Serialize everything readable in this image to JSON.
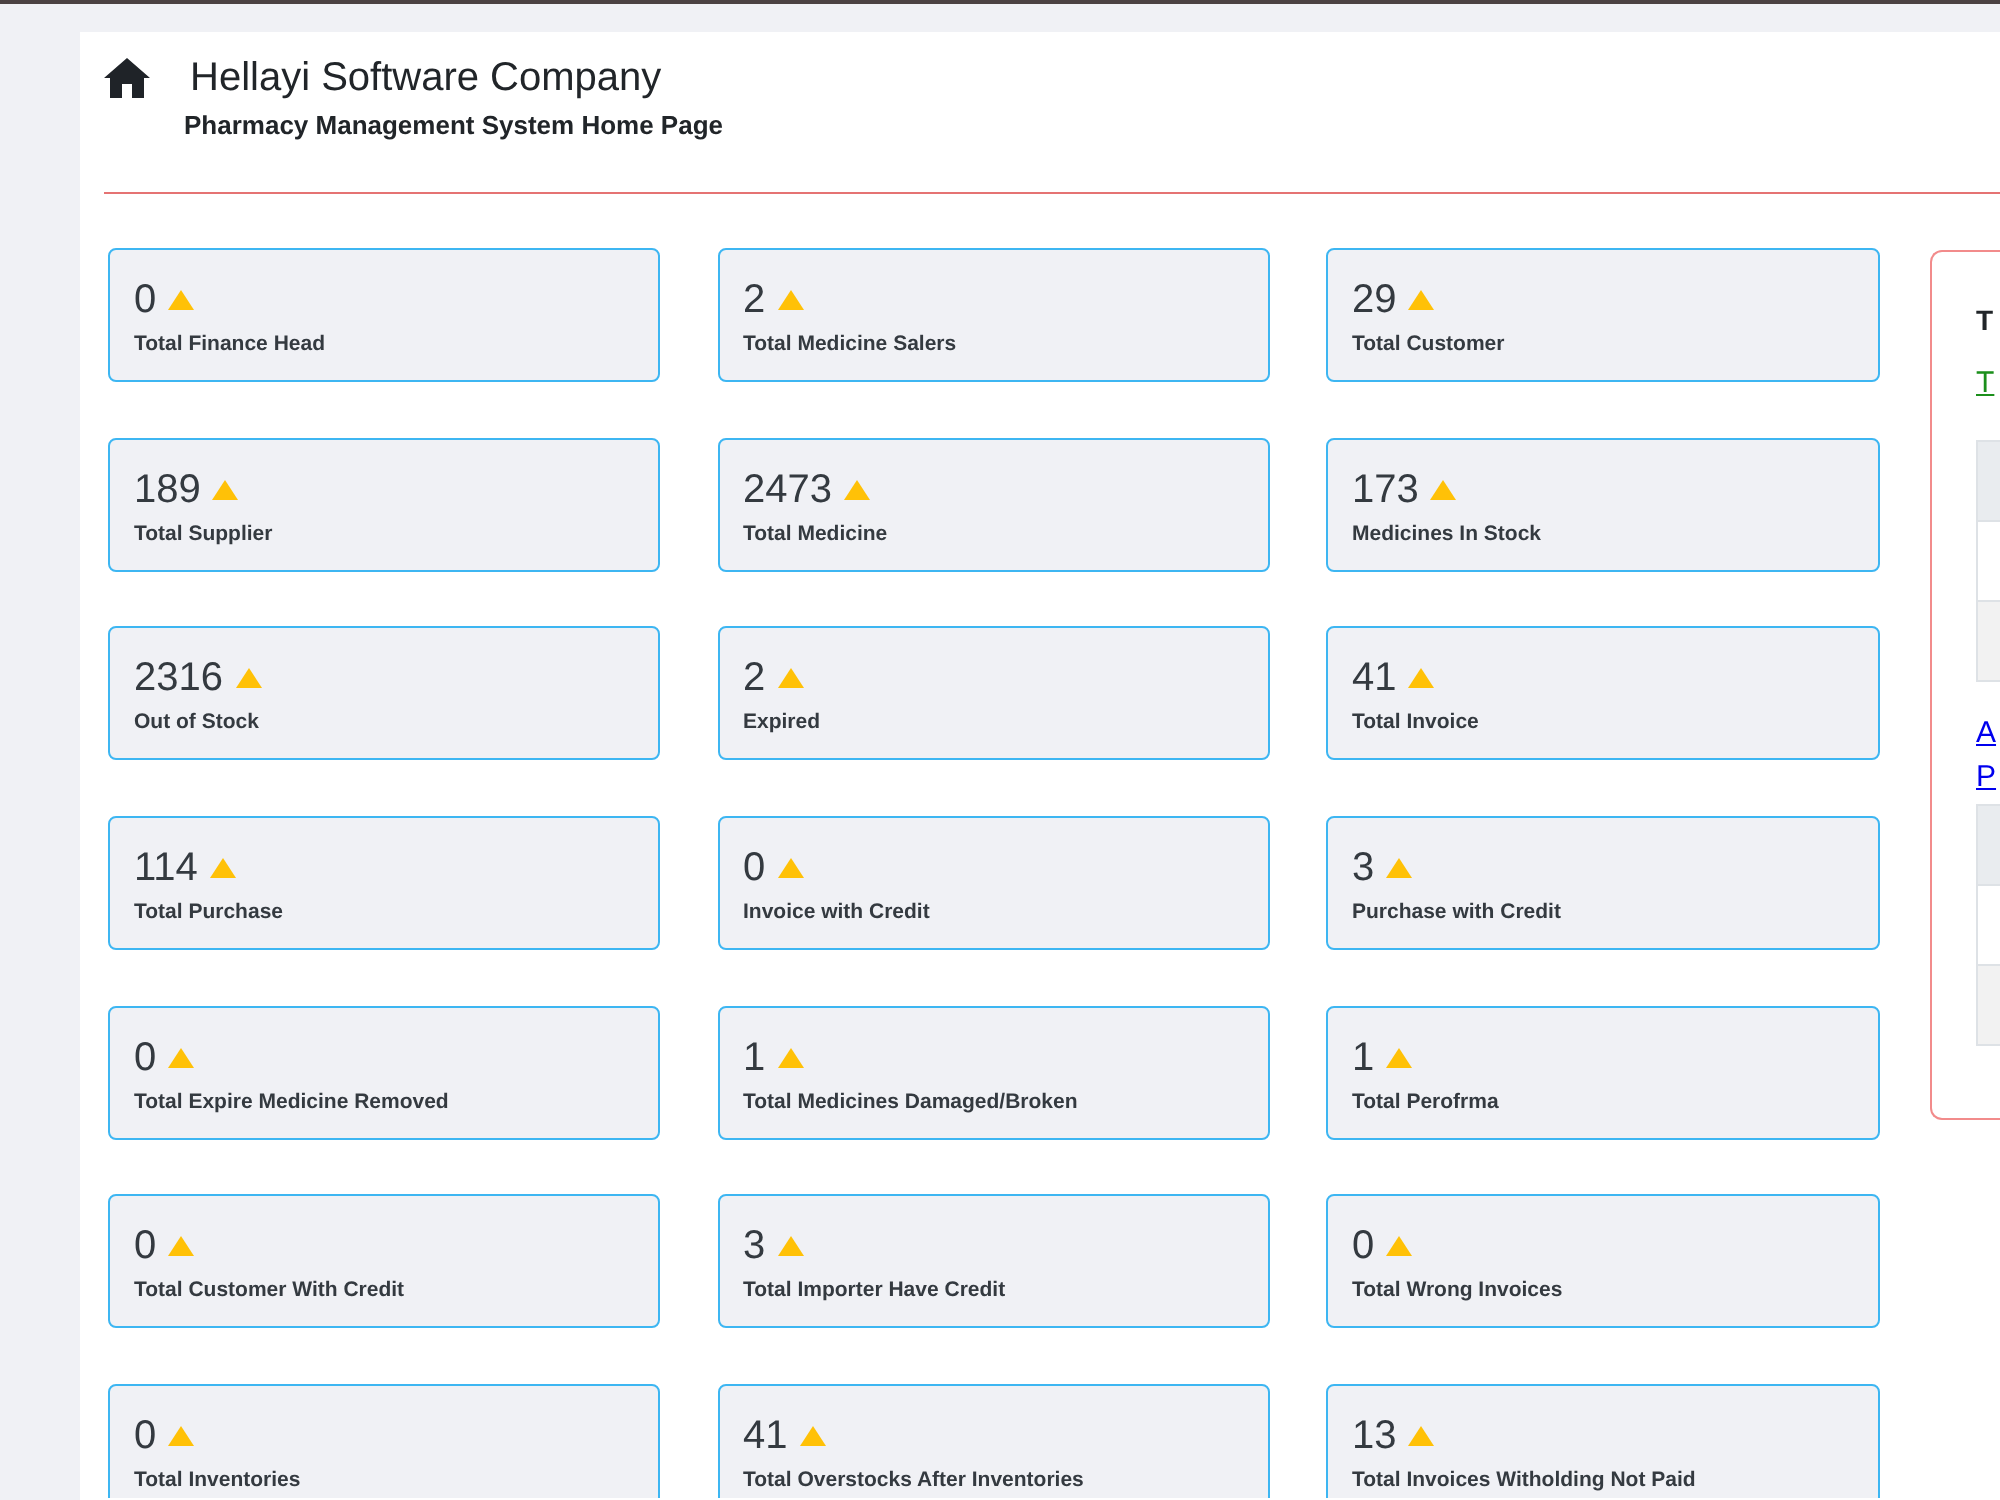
{
  "header": {
    "title": "Hellayi Software Company",
    "subtitle": "Pharmacy Management System Home Page"
  },
  "stats": [
    {
      "value": "0",
      "label": "Total Finance Head"
    },
    {
      "value": "2",
      "label": "Total Medicine Salers"
    },
    {
      "value": "29",
      "label": "Total Customer"
    },
    {
      "value": "189",
      "label": "Total Supplier"
    },
    {
      "value": "2473",
      "label": "Total Medicine"
    },
    {
      "value": "173",
      "label": "Medicines In Stock"
    },
    {
      "value": "2316",
      "label": "Out of Stock"
    },
    {
      "value": "2",
      "label": "Expired"
    },
    {
      "value": "41",
      "label": "Total Invoice"
    },
    {
      "value": "114",
      "label": "Total Purchase"
    },
    {
      "value": "0",
      "label": "Invoice with Credit"
    },
    {
      "value": "3",
      "label": "Purchase with Credit"
    },
    {
      "value": "0",
      "label": "Total Expire Medicine Removed"
    },
    {
      "value": "1",
      "label": "Total Medicines Damaged/Broken"
    },
    {
      "value": "1",
      "label": "Total Perofrma"
    },
    {
      "value": "0",
      "label": "Total Customer With Credit"
    },
    {
      "value": "3",
      "label": "Total Importer Have Credit"
    },
    {
      "value": "0",
      "label": "Total Wrong Invoices"
    },
    {
      "value": "0",
      "label": "Total Inventories"
    },
    {
      "value": "41",
      "label": "Total Overstocks After Inventories"
    },
    {
      "value": "13",
      "label": "Total Invoices Witholding Not Paid"
    }
  ],
  "side_panel": {
    "heading": "T",
    "sections": [
      {
        "links": [
          {
            "text": "T",
            "color": "#1b8f1b"
          }
        ],
        "table_rows": [
          {
            "kind": "header"
          },
          {
            "kind": "plain"
          },
          {
            "kind": "striped"
          }
        ]
      },
      {
        "links": [
          {
            "text": "A",
            "color": "#0000ee"
          },
          {
            "text": "P",
            "color": "#0000ee"
          }
        ],
        "table_rows": [
          {
            "kind": "header"
          },
          {
            "kind": "plain"
          },
          {
            "kind": "striped"
          }
        ]
      }
    ]
  }
}
